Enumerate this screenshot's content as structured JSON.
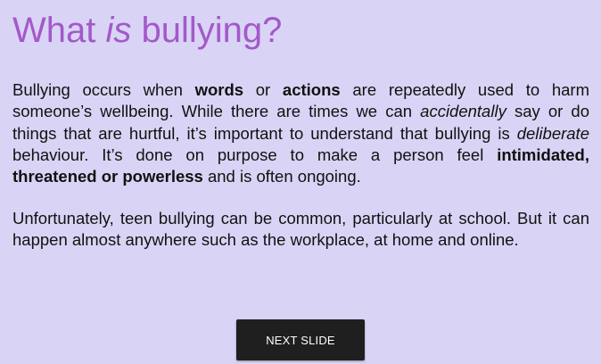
{
  "title": {
    "part1": "What ",
    "emphasis": "is",
    "part2": " bullying?"
  },
  "paragraph1": {
    "s1": "Bullying occurs when ",
    "b1": "words",
    "s2": " or ",
    "b2": "actions",
    "s3": " are repeatedly used to harm someone’s wellbeing. While there are times we can ",
    "i1": "accidentally",
    "s4": " say or do things that are hurtful, it’s important to understand that bullying is ",
    "i2": "deliberate",
    "s5": " behaviour. It’s done on purpose to make a person feel ",
    "b3": "intimidated, threatened or powerless",
    "s6": " and is often ongoing."
  },
  "paragraph2": {
    "text": "Unfortunately, teen bullying can be common, particularly at school. But it can happen almost anywhere such as the workplace, at home and online."
  },
  "next_button": {
    "label": "NEXT SLIDE"
  },
  "colors": {
    "background": "#d9d4f5",
    "title": "#a359c9",
    "button": "#1f1f1f"
  }
}
